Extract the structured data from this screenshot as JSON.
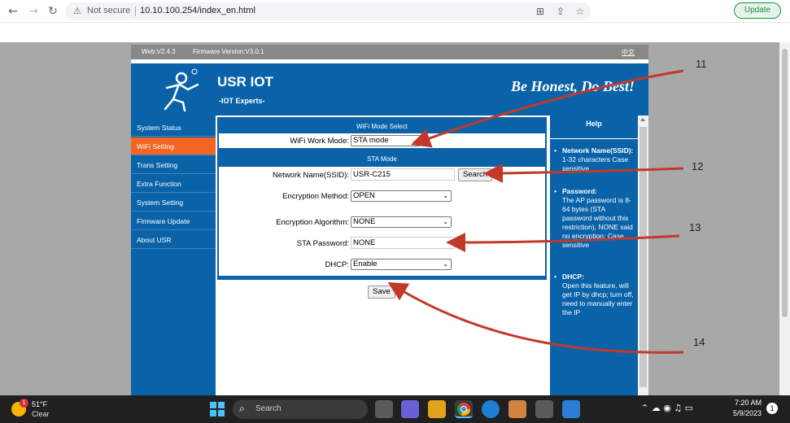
{
  "browser": {
    "security_label": "Not secure",
    "url": "10.10.100.254/index_en.html",
    "update_label": "Update",
    "back_icon": "←",
    "forward_icon": "→",
    "reload_icon": "↻",
    "warn_icon": "⚠"
  },
  "page": {
    "web_version": "Web:V2.4.3",
    "firmware_version": "Firmware Version:V3.0.1",
    "language_link": "中文",
    "brand": "USR IOT",
    "tagline": "-IOT Experts-",
    "slogan": "Be Honest, Do Best!"
  },
  "sidebar": {
    "items": [
      {
        "label": "System Status"
      },
      {
        "label": "WiFi Setting"
      },
      {
        "label": "Trans Setting"
      },
      {
        "label": "Extra Function"
      },
      {
        "label": "System Setting"
      },
      {
        "label": "Firmware Update"
      },
      {
        "label": "About USR"
      }
    ]
  },
  "form": {
    "mode_section_title": "WiFi Mode Select",
    "work_mode_label": "WiFi Work Mode:",
    "work_mode_value": "STA mode",
    "sta_section_title": "STA Mode",
    "ssid_label": "Network Name(SSID):",
    "ssid_value": "USR-C215",
    "search_button": "Search",
    "encryption_method_label": "Encryption Method:",
    "encryption_method_value": "OPEN",
    "encryption_algorithm_label": "Encryption Algorithm:",
    "encryption_algorithm_value": "NONE",
    "sta_password_label": "STA Password:",
    "sta_password_value": "NONE",
    "dhcp_label": "DHCP:",
    "dhcp_value": "Enable",
    "save_button": "Save"
  },
  "help": {
    "title": "Help",
    "items": [
      {
        "heading": "Network Name(SSID):",
        "text": "1-32 characters Case sensitive"
      },
      {
        "heading": "Password:",
        "text": "The AP password is 8-64 bytes (STA password without this restriction), NONE said no encryption; Case sensitive"
      },
      {
        "heading": "DHCP:",
        "text": "Open this feature, will get IP by dhcp; turn off, need to manually enter the IP"
      }
    ]
  },
  "annotations": {
    "n11": "11",
    "n12": "12",
    "n13": "13",
    "n14": "14",
    "arrow_color": "#c0392b"
  },
  "taskbar": {
    "temperature": "51°F",
    "condition": "Clear",
    "weather_badge": "1",
    "search_label": "Search",
    "time": "7:20 AM",
    "date": "5/9/2023",
    "notification_count": "1"
  }
}
